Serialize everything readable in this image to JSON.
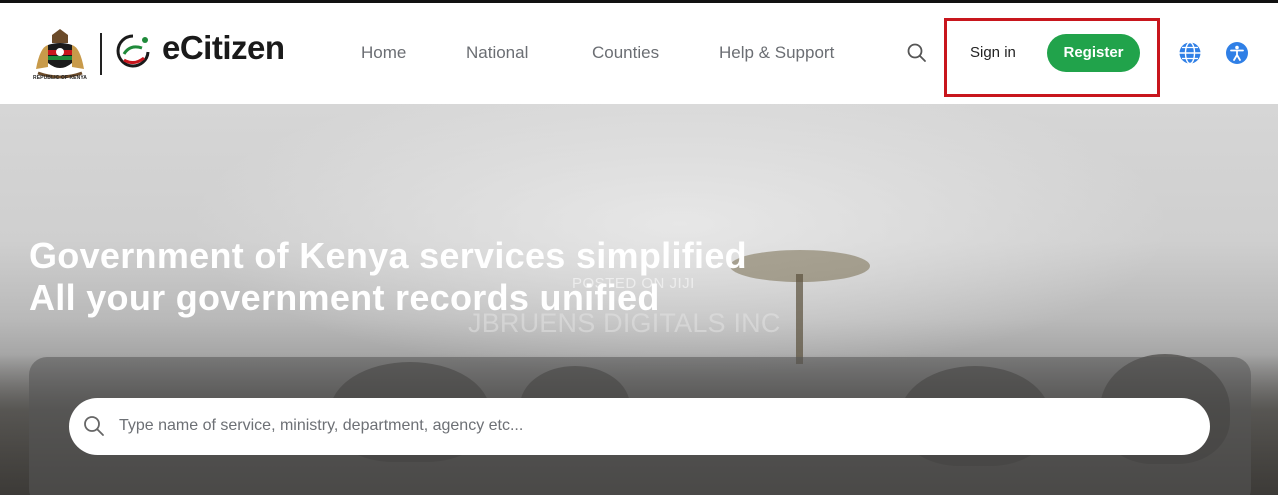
{
  "header": {
    "coat_caption": "REPUBLIC OF KENYA",
    "brand": "eCitizen",
    "nav": [
      "Home",
      "National",
      "Counties",
      "Help & Support"
    ],
    "signin_label": "Sign in",
    "register_label": "Register"
  },
  "hero": {
    "line1_a": "Government of Kenya services ",
    "line1_b": "simplified",
    "line2_a": "All your government records ",
    "line2_b": "unified",
    "search_placeholder": "Type name of service, ministry, department, agency etc..."
  },
  "watermark": {
    "line1": "POSTED ON JIJI",
    "line2": "JBRUENS DIGITALS INC"
  },
  "colors": {
    "register_green": "#21a34b",
    "highlight_red": "#c8161d",
    "icon_blue": "#2f7fe6"
  },
  "icons": [
    "coat-of-arms-icon",
    "ecitizen-logo-icon",
    "search-icon",
    "globe-language-icon",
    "accessibility-icon"
  ]
}
